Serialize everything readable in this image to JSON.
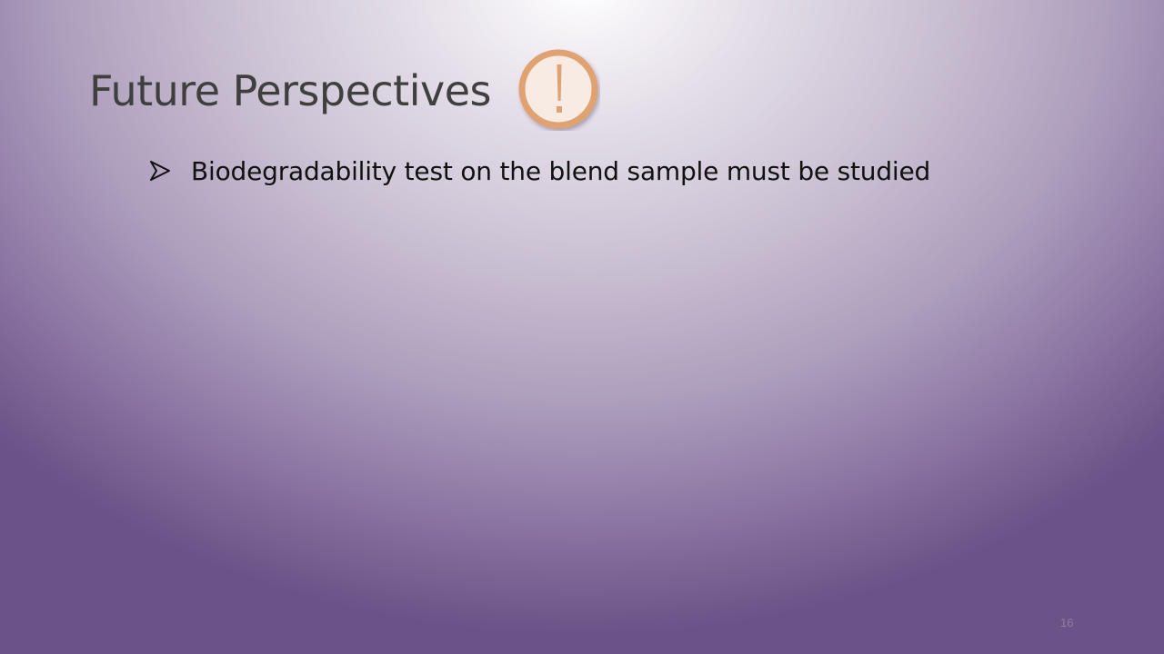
{
  "slide": {
    "title": "Future Perspectives",
    "title_icon": "exclamation-circle-icon",
    "bullets": [
      {
        "icon": "arrowhead-bullet-icon",
        "text": "Biodegradability  test on the blend sample must be studied"
      }
    ],
    "page_number": "16"
  },
  "colors": {
    "title_text": "#3f3f3f",
    "bullet_text": "#111111",
    "icon_ring": "#e0a271",
    "icon_fill": "#f7ebe4",
    "background_center": "#ffffff",
    "background_edge": "#6b5287"
  }
}
